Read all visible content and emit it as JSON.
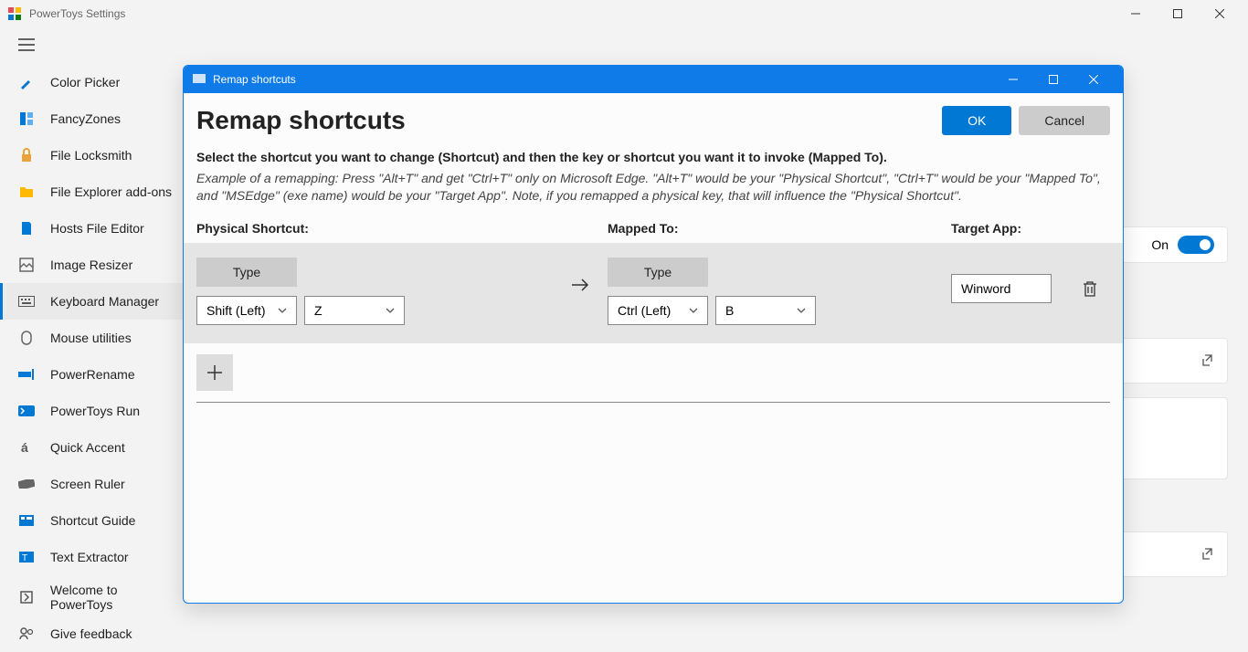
{
  "app": {
    "title": "PowerToys Settings"
  },
  "sidebar": {
    "items": [
      {
        "label": "Color Picker"
      },
      {
        "label": "FancyZones"
      },
      {
        "label": "File Locksmith"
      },
      {
        "label": "File Explorer add-ons"
      },
      {
        "label": "Hosts File Editor"
      },
      {
        "label": "Image Resizer"
      },
      {
        "label": "Keyboard Manager"
      },
      {
        "label": "Mouse utilities"
      },
      {
        "label": "PowerRename"
      },
      {
        "label": "PowerToys Run"
      },
      {
        "label": "Quick Accent"
      },
      {
        "label": "Screen Ruler"
      },
      {
        "label": "Shortcut Guide"
      },
      {
        "label": "Text Extractor"
      },
      {
        "label": "Welcome to PowerToys"
      },
      {
        "label": "Give feedback"
      }
    ]
  },
  "bg": {
    "on_label": "On"
  },
  "dialog": {
    "title": "Remap shortcuts",
    "heading": "Remap shortcuts",
    "ok_label": "OK",
    "cancel_label": "Cancel",
    "desc": "Select the shortcut you want to change (Shortcut) and then the key or shortcut you want it to invoke (Mapped To).",
    "example": "Example of a remapping: Press \"Alt+T\" and get \"Ctrl+T\" only on Microsoft Edge. \"Alt+T\" would be your \"Physical Shortcut\", \"Ctrl+T\" would be your \"Mapped To\", and \"MSEdge\" (exe name) would be your \"Target App\". Note, if you remapped a physical key, that will influence the \"Physical Shortcut\".",
    "columns": {
      "physical": "Physical Shortcut:",
      "mapped": "Mapped To:",
      "target": "Target App:"
    },
    "row": {
      "type_label": "Type",
      "physical_key1": "Shift (Left)",
      "physical_key2": "Z",
      "mapped_key1": "Ctrl (Left)",
      "mapped_key2": "B",
      "target_app": "Winword"
    }
  }
}
